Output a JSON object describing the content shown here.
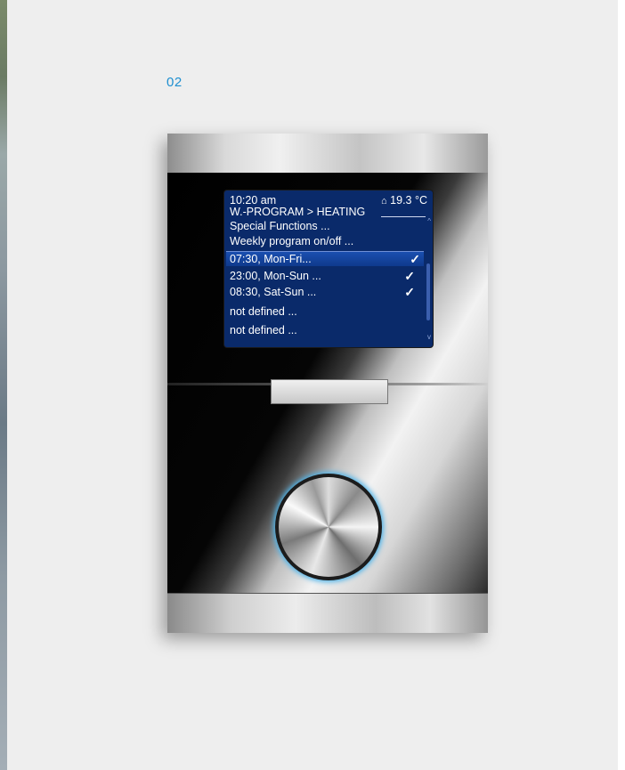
{
  "figure_label": "02",
  "display": {
    "time": "10:20 am",
    "temperature": "19.3 °C",
    "title": "W.-PROGRAM > HEATING",
    "items": [
      {
        "label": "Special Functions ...",
        "checked": false,
        "selected": false
      },
      {
        "label": "Weekly program on/off ...",
        "checked": false,
        "selected": false
      },
      {
        "label": "07:30, Mon-Fri...",
        "checked": true,
        "selected": true
      },
      {
        "label": "23:00, Mon-Sun ...",
        "checked": true,
        "selected": false
      },
      {
        "label": "08:30, Sat-Sun ...",
        "checked": true,
        "selected": false
      },
      {
        "label": "not defined ...",
        "checked": false,
        "selected": false
      },
      {
        "label": "not defined ...",
        "checked": false,
        "selected": false
      }
    ],
    "check_glyph": "✓",
    "temp_icon": "thermometer-house-icon",
    "accent_color": "#1e8fd0",
    "screen_bg": "#0a2a6a"
  }
}
